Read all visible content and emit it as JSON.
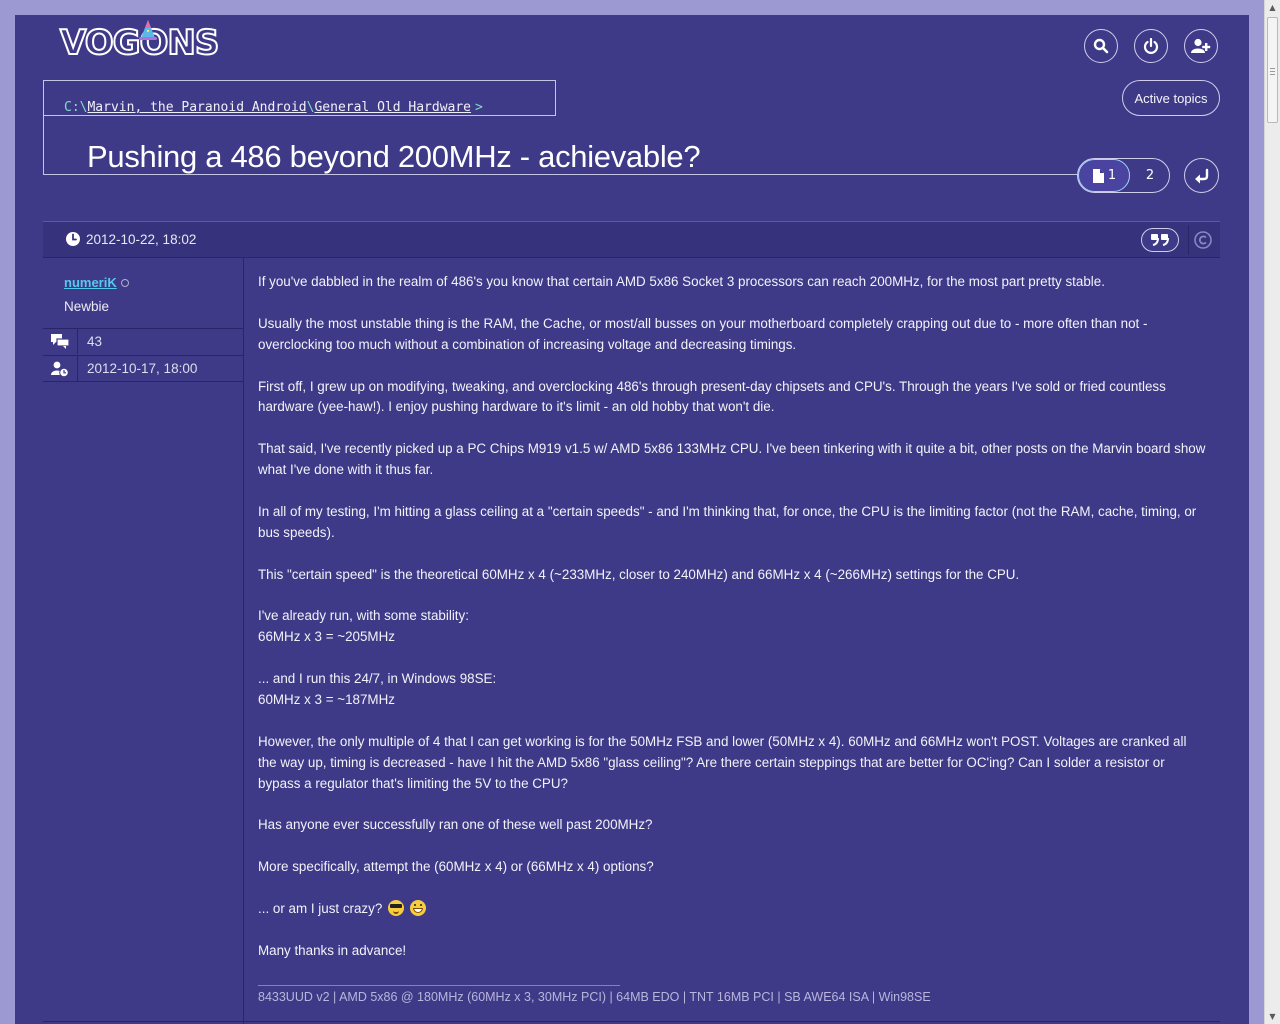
{
  "site": {
    "logo_text": "VOGONS"
  },
  "header": {
    "search_icon": "search-icon",
    "login_icon": "power-icon",
    "register_icon": "add-user-icon",
    "active_topics_label": "Active topics"
  },
  "breadcrumb": {
    "drive": "C:\\",
    "items": [
      "Marvin, the Paranoid Android",
      "General Old Hardware"
    ],
    "separator": "\\",
    "end": ">"
  },
  "topic": {
    "title": "Pushing a 486 beyond 200MHz - achievable?"
  },
  "pagination": {
    "pages": [
      "1",
      "2"
    ],
    "current": "1"
  },
  "post": {
    "date": "2012-10-22, 18:02",
    "author": "numeriK",
    "rank": "Newbie",
    "post_count": "43",
    "joined": "2012-10-17, 18:00",
    "paragraphs": [
      "If you've dabbled in the realm of 486's you know that certain AMD 5x86 Socket 3 processors can reach 200MHz, for the most part pretty stable.",
      "Usually the most unstable thing is the RAM, the Cache, or most/all busses on your motherboard completely crapping out due to - more often than not - overclocking too much without a combination of increasing voltage and decreasing timings.",
      "First off, I grew up on modifying, tweaking, and overclocking 486's through present-day chipsets and CPU's. Through the years I've sold or fried countless hardware (yee-haw!). I enjoy pushing hardware to it's limit - an old hobby that won't die.",
      "That said, I've recently picked up a PC Chips M919 v1.5 w/ AMD 5x86 133MHz CPU. I've been tinkering with it quite a bit, other posts on the Marvin board show what I've done with it thus far.",
      "In all of my testing, I'm hitting a glass ceiling at a \"certain speeds\" - and I'm thinking that, for once, the CPU is the limiting factor (not the RAM, cache, timing, or bus speeds).",
      "This \"certain speed\" is the theoretical 60MHz x 4 (~233MHz, closer to 240MHz) and 66MHz x 4 (~266MHz) settings for the CPU.",
      "I've already run, with some stability:",
      "66MHz x 3 = ~205MHz",
      "... and I run this 24/7, in Windows 98SE:",
      "60MHz x 3 = ~187MHz",
      "However, the only multiple of 4 that I can get working is for the 50MHz FSB and lower (50MHz x 4). 60MHz and 66MHz won't POST. Voltages are cranked all the way up, timing is decreased - have I hit the AMD 5x86 \"glass ceiling\"? Are there certain steppings that are better for OC'ing? Can I solder a resistor or bypass a regulator that's limiting the 5V to the CPU?",
      "Has anyone ever successfully ran one of these well past 200MHz?",
      "More specifically, attempt the (60MHz x 4) or (66MHz x 4) options?",
      "... or am I just crazy?",
      "Many thanks in advance!"
    ],
    "signature": "8433UUD v2 | AMD 5x86 @ 180MHz (60MHz x 3, 30MHz PCI) | 64MB EDO | TNT 16MB PCI | SB AWE64 ISA | Win98SE"
  },
  "colors": {
    "background": "#3f3a88",
    "frame": "#9b98d2",
    "author_link": "#55c8f0",
    "accent_green": "#7ee0c4"
  }
}
